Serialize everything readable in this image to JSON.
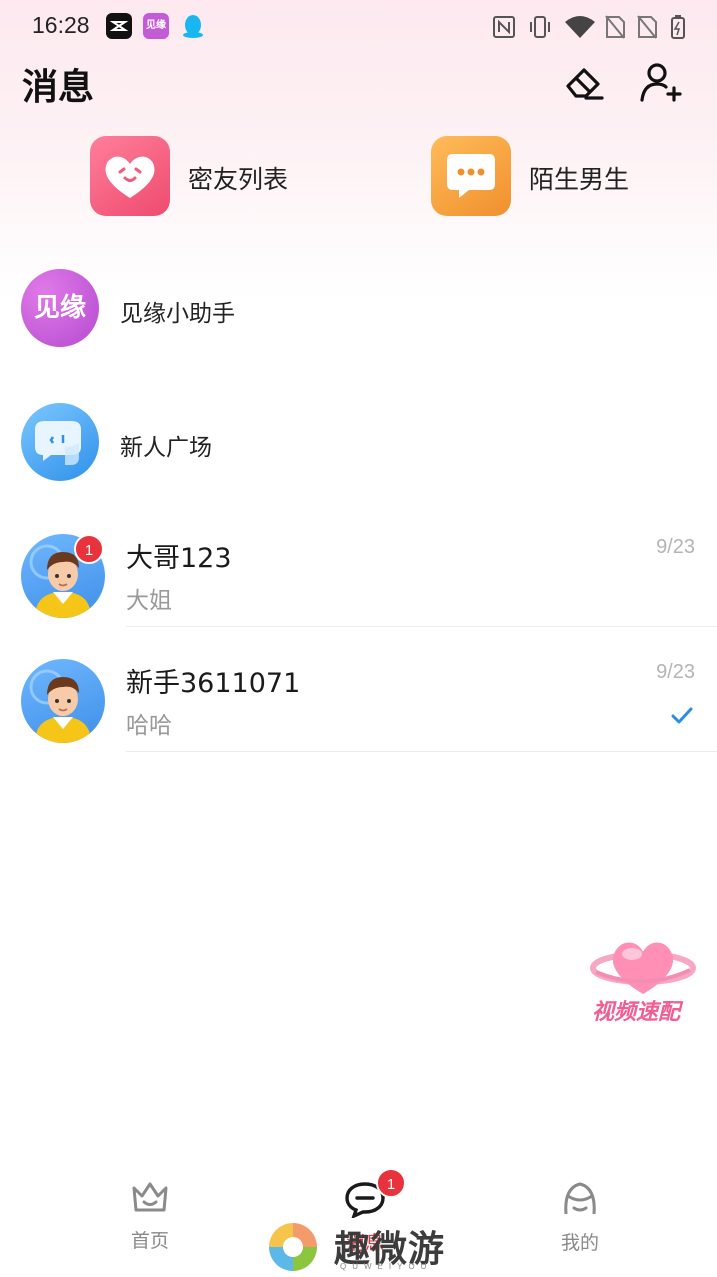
{
  "status_bar": {
    "time": "16:28",
    "apps": [
      {
        "icon": "capcut-icon",
        "color": "#111111"
      },
      {
        "icon": "jianyuan-app-icon",
        "label": "见缘",
        "color": "#c45bd6"
      },
      {
        "icon": "qq-penguin-icon",
        "color": "#19b7f2"
      }
    ],
    "indicators": [
      "nfc-icon",
      "vibrate-icon",
      "wifi-icon",
      "no-sim-icon",
      "no-sim-icon",
      "battery-icon"
    ]
  },
  "header": {
    "title": "消息",
    "actions": [
      {
        "icon": "eraser-icon",
        "label": "clear-unread"
      },
      {
        "icon": "add-friend-icon",
        "label": "add-friend"
      }
    ]
  },
  "quick_entries": [
    {
      "label": "密友列表",
      "icon": "heart-face-icon",
      "color": "#f35a7e"
    },
    {
      "label": "陌生男生",
      "icon": "chat-bubble-icon",
      "color": "#f5a23f"
    }
  ],
  "system_items": [
    {
      "name": "见缘小助手",
      "avatar_text": "见缘",
      "color": "#c45bd6"
    },
    {
      "name": "新人广场",
      "icon": "chat-bot-icon",
      "color": "#3ea6f2"
    }
  ],
  "conversations": [
    {
      "name": "大哥123",
      "message": "大姐",
      "date": "9/23",
      "unread": "1",
      "read_check": false
    },
    {
      "name": "新手3611071",
      "message": "哈哈",
      "date": "9/23",
      "unread": "",
      "read_check": true
    }
  ],
  "floating_action": {
    "label": "视频速配",
    "icon": "heart-planet-icon"
  },
  "tabbar": {
    "tabs": [
      {
        "label": "首页",
        "icon": "crown-home-icon",
        "active": false
      },
      {
        "label": "消息",
        "icon": "message-icon",
        "active": true,
        "badge": "1"
      },
      {
        "label": "我的",
        "icon": "profile-face-icon",
        "active": false
      }
    ]
  },
  "watermark": {
    "text": "趣微游",
    "sub": "QUWEIYOU"
  },
  "colors": {
    "accent": "#e8323c",
    "check": "#2b8de8"
  }
}
